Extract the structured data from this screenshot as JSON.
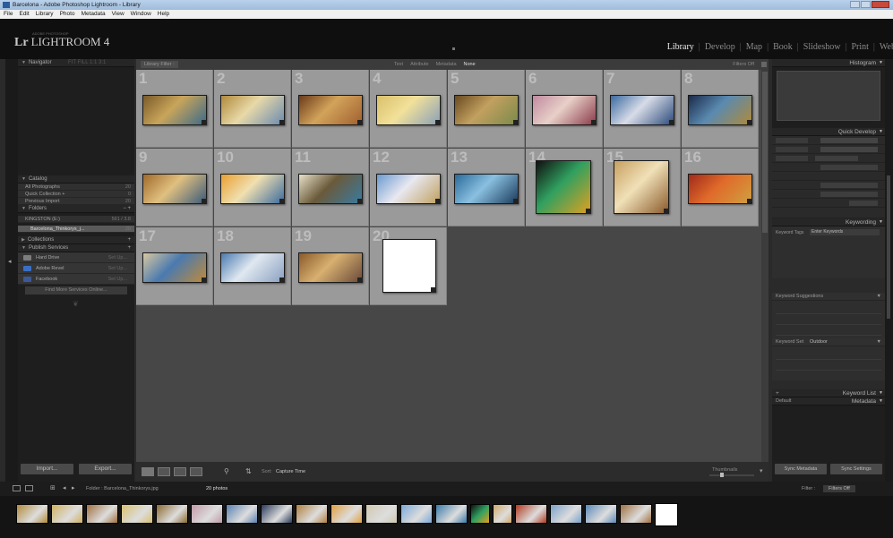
{
  "window": {
    "title": "Barcelona - Adobe Photoshop Lightroom - Library"
  },
  "menu": [
    "File",
    "Edit",
    "Library",
    "Photo",
    "Metadata",
    "View",
    "Window",
    "Help"
  ],
  "brand": {
    "lr": "Lr",
    "subtitle": "ADOBE PHOTOSHOP",
    "name": "LIGHTROOM 4"
  },
  "modules": [
    "Library",
    "Develop",
    "Map",
    "Book",
    "Slideshow",
    "Print",
    "Web"
  ],
  "active_module": "Library",
  "left_panel": {
    "navigator": {
      "label": "Navigator",
      "opts": "FIT  FILL  1:1  3:1"
    },
    "catalog": {
      "label": "Catalog",
      "items": [
        {
          "label": "All Photographs",
          "count": "20"
        },
        {
          "label": "Quick Collection +",
          "count": "0"
        },
        {
          "label": "Previous Import",
          "count": "20"
        }
      ]
    },
    "folders": {
      "label": "Folders",
      "volume": {
        "label": "KINGSTON (E:)",
        "count": "561 / 3.8"
      },
      "items": [
        {
          "label": "Barcelona_Thinkorys_j...",
          "count": "20"
        }
      ]
    },
    "collections": {
      "label": "Collections"
    },
    "publish": {
      "label": "Publish Services",
      "services": [
        {
          "label": "Hard Drive",
          "color": "#7d7d7d",
          "sub": "Set Up..."
        },
        {
          "label": "Adobe Revel",
          "color": "#3a6fc4",
          "sub": "Set Up..."
        },
        {
          "label": "Facebook",
          "color": "#3b5998",
          "sub": "Set Up..."
        }
      ],
      "find_more": "Find More Services Online..."
    },
    "import_label": "Import...",
    "export_label": "Export..."
  },
  "filter_bar": {
    "title": "Library Filter :",
    "options": [
      "Text",
      "Attribute",
      "Metadata",
      "None"
    ],
    "active": "None",
    "filters_off": "Filters Off"
  },
  "grid": {
    "cells": [
      {
        "n": "1",
        "colors": [
          "#7a5a2a",
          "#c9a55a",
          "#3c6a8a"
        ]
      },
      {
        "n": "2",
        "colors": [
          "#b08a3a",
          "#e8d9a8",
          "#6a8ab0"
        ]
      },
      {
        "n": "3",
        "colors": [
          "#6b3a1a",
          "#d2a35a",
          "#a06030"
        ]
      },
      {
        "n": "4",
        "colors": [
          "#d9c06a",
          "#f2e19a",
          "#8aa0b8"
        ]
      },
      {
        "n": "5",
        "colors": [
          "#6a4a20",
          "#c2a060",
          "#7a8a4a"
        ]
      },
      {
        "n": "6",
        "colors": [
          "#c08aa0",
          "#e8d0c8",
          "#8a3a4a"
        ]
      },
      {
        "n": "7",
        "colors": [
          "#3a6aa0",
          "#d8dce8",
          "#2a4a7a"
        ]
      },
      {
        "n": "8",
        "colors": [
          "#1a2a4a",
          "#5a8ab0",
          "#b08a3a"
        ]
      },
      {
        "n": "9",
        "colors": [
          "#a06a2a",
          "#e0c080",
          "#3a5a7a"
        ]
      },
      {
        "n": "10",
        "colors": [
          "#e8a030",
          "#f0e0b0",
          "#3a6aa0"
        ]
      },
      {
        "n": "11",
        "colors": [
          "#e8e0c8",
          "#6a5a3a",
          "#3a7aa0"
        ]
      },
      {
        "n": "12",
        "colors": [
          "#6a9ad0",
          "#e8e8f0",
          "#c0a060"
        ]
      },
      {
        "n": "13",
        "colors": [
          "#2a6a9a",
          "#8ac0e0",
          "#1a3a5a"
        ]
      },
      {
        "n": "14",
        "colors": [
          "#101010",
          "#30a060",
          "#e0a020"
        ]
      },
      {
        "n": "15",
        "colors": [
          "#c8a060",
          "#f0e0b8",
          "#8a5a2a"
        ]
      },
      {
        "n": "16",
        "colors": [
          "#a02a1a",
          "#e06a2a",
          "#d0a040"
        ]
      },
      {
        "n": "17",
        "colors": [
          "#d8c8a0",
          "#4a7ab0",
          "#c08a3a"
        ]
      },
      {
        "n": "18",
        "colors": [
          "#4a7ab0",
          "#e0e8f0",
          "#8aa0c0"
        ]
      },
      {
        "n": "19",
        "colors": [
          "#8a5a2a",
          "#d8b070",
          "#6a4a3a"
        ]
      },
      {
        "n": "20",
        "colors": [
          "#ffffff",
          "#f4f4f4",
          "#e8e8e8"
        ]
      }
    ]
  },
  "toolbar": {
    "sort_label": "Sort:",
    "sort_value": "Capture Time",
    "thumbnails_label": "Thumbnails"
  },
  "right_panel": {
    "histogram_label": "Histogram",
    "quick_develop_label": "Quick Develop",
    "keywording_label": "Keywording",
    "keyword_tags_label": "Keyword Tags",
    "keyword_tags_value": "Enter Keywords",
    "keyword_suggestions_label": "Keyword Suggestions",
    "keyword_set_label": "Keyword Set",
    "keyword_set_value": "Outdoor",
    "keyword_list_label": "Keyword List",
    "default_label": "Default",
    "metadata_label": "Metadata",
    "sync_metadata_label": "Sync Metadata",
    "sync_settings_label": "Sync Settings"
  },
  "filmstrip_bar": {
    "path": "Folder : Barcelona_Thinkorys.jpg",
    "selected": "20 photos",
    "filter_label": "Filter :",
    "filter_value": "Filters Off"
  },
  "filmstrip": {
    "thumbs": [
      "#b08a3a",
      "#d0b060",
      "#a07040",
      "#d8c070",
      "#8a6a30",
      "#c09aa8",
      "#5a80b0",
      "#2a3a5a",
      "#b08040",
      "#e0a040",
      "#d0c8b0",
      "#7aa8d8",
      "#3a7aa8",
      "#101010",
      "#d0a868",
      "#b03a20",
      "#7aa0c8",
      "#5a88b8",
      "#a07040",
      "#ffffff"
    ]
  }
}
